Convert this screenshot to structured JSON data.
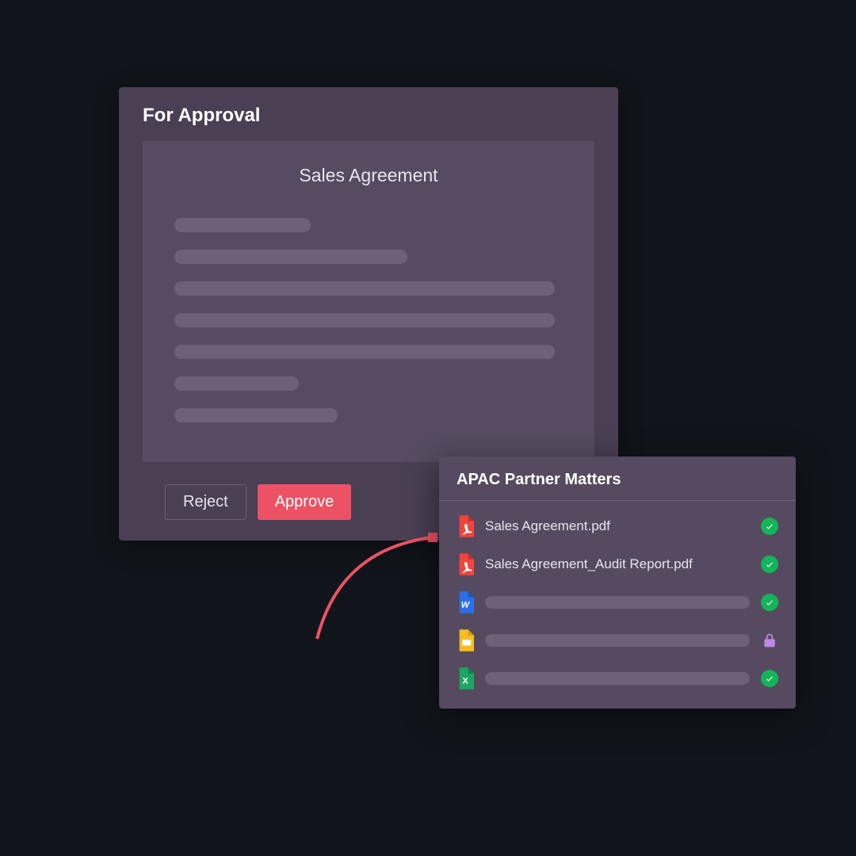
{
  "approval": {
    "header": "For Approval",
    "document_title": "Sales Agreement",
    "buttons": {
      "reject": "Reject",
      "approve": "Approve"
    }
  },
  "files_panel": {
    "title": "APAC Partner Matters",
    "items": [
      {
        "icon": "pdf",
        "name": "Sales Agreement.pdf",
        "status": "check"
      },
      {
        "icon": "pdf",
        "name": "Sales Agreement_Audit Report.pdf",
        "status": "check"
      },
      {
        "icon": "word",
        "name": "",
        "status": "check"
      },
      {
        "icon": "slides",
        "name": "",
        "status": "lock"
      },
      {
        "icon": "excel",
        "name": "",
        "status": "check"
      }
    ]
  },
  "colors": {
    "accent_red": "#ec5264",
    "accent_green": "#14b45a",
    "accent_purple": "#c08ae8",
    "pdf": "#f0453d",
    "word": "#2a6fe8",
    "slides": "#f7bd1e",
    "excel": "#1fa463"
  }
}
